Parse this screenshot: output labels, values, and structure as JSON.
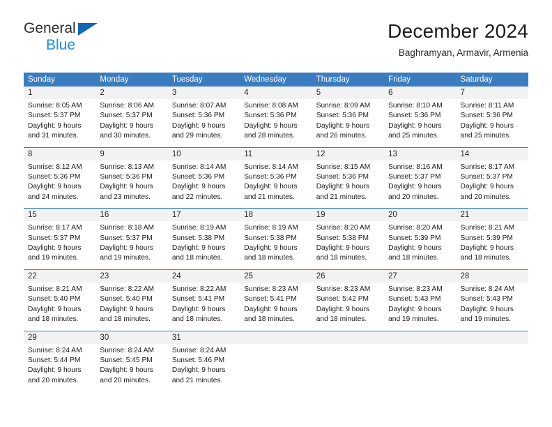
{
  "logo": {
    "word1": "General",
    "word2": "Blue",
    "triangle_color": "#1168b3",
    "word2_color": "#1b8ae0"
  },
  "header": {
    "title": "December 2024",
    "subtitle": "Baghramyan, Armavir, Armenia"
  },
  "theme": {
    "header_row_color": "#3b7cc0",
    "daynum_row_color": "#f2f2f2",
    "cell_bg": "#ffffff",
    "text_color": "#1a1a1a"
  },
  "weekdays": [
    "Sunday",
    "Monday",
    "Tuesday",
    "Wednesday",
    "Thursday",
    "Friday",
    "Saturday"
  ],
  "weeks": [
    [
      {
        "day": "1",
        "sunrise": "Sunrise: 8:05 AM",
        "sunset": "Sunset: 5:37 PM",
        "daylight1": "Daylight: 9 hours",
        "daylight2": "and 31 minutes."
      },
      {
        "day": "2",
        "sunrise": "Sunrise: 8:06 AM",
        "sunset": "Sunset: 5:37 PM",
        "daylight1": "Daylight: 9 hours",
        "daylight2": "and 30 minutes."
      },
      {
        "day": "3",
        "sunrise": "Sunrise: 8:07 AM",
        "sunset": "Sunset: 5:36 PM",
        "daylight1": "Daylight: 9 hours",
        "daylight2": "and 29 minutes."
      },
      {
        "day": "4",
        "sunrise": "Sunrise: 8:08 AM",
        "sunset": "Sunset: 5:36 PM",
        "daylight1": "Daylight: 9 hours",
        "daylight2": "and 28 minutes."
      },
      {
        "day": "5",
        "sunrise": "Sunrise: 8:09 AM",
        "sunset": "Sunset: 5:36 PM",
        "daylight1": "Daylight: 9 hours",
        "daylight2": "and 26 minutes."
      },
      {
        "day": "6",
        "sunrise": "Sunrise: 8:10 AM",
        "sunset": "Sunset: 5:36 PM",
        "daylight1": "Daylight: 9 hours",
        "daylight2": "and 25 minutes."
      },
      {
        "day": "7",
        "sunrise": "Sunrise: 8:11 AM",
        "sunset": "Sunset: 5:36 PM",
        "daylight1": "Daylight: 9 hours",
        "daylight2": "and 25 minutes."
      }
    ],
    [
      {
        "day": "8",
        "sunrise": "Sunrise: 8:12 AM",
        "sunset": "Sunset: 5:36 PM",
        "daylight1": "Daylight: 9 hours",
        "daylight2": "and 24 minutes."
      },
      {
        "day": "9",
        "sunrise": "Sunrise: 8:13 AM",
        "sunset": "Sunset: 5:36 PM",
        "daylight1": "Daylight: 9 hours",
        "daylight2": "and 23 minutes."
      },
      {
        "day": "10",
        "sunrise": "Sunrise: 8:14 AM",
        "sunset": "Sunset: 5:36 PM",
        "daylight1": "Daylight: 9 hours",
        "daylight2": "and 22 minutes."
      },
      {
        "day": "11",
        "sunrise": "Sunrise: 8:14 AM",
        "sunset": "Sunset: 5:36 PM",
        "daylight1": "Daylight: 9 hours",
        "daylight2": "and 21 minutes."
      },
      {
        "day": "12",
        "sunrise": "Sunrise: 8:15 AM",
        "sunset": "Sunset: 5:36 PM",
        "daylight1": "Daylight: 9 hours",
        "daylight2": "and 21 minutes."
      },
      {
        "day": "13",
        "sunrise": "Sunrise: 8:16 AM",
        "sunset": "Sunset: 5:37 PM",
        "daylight1": "Daylight: 9 hours",
        "daylight2": "and 20 minutes."
      },
      {
        "day": "14",
        "sunrise": "Sunrise: 8:17 AM",
        "sunset": "Sunset: 5:37 PM",
        "daylight1": "Daylight: 9 hours",
        "daylight2": "and 20 minutes."
      }
    ],
    [
      {
        "day": "15",
        "sunrise": "Sunrise: 8:17 AM",
        "sunset": "Sunset: 5:37 PM",
        "daylight1": "Daylight: 9 hours",
        "daylight2": "and 19 minutes."
      },
      {
        "day": "16",
        "sunrise": "Sunrise: 8:18 AM",
        "sunset": "Sunset: 5:37 PM",
        "daylight1": "Daylight: 9 hours",
        "daylight2": "and 19 minutes."
      },
      {
        "day": "17",
        "sunrise": "Sunrise: 8:19 AM",
        "sunset": "Sunset: 5:38 PM",
        "daylight1": "Daylight: 9 hours",
        "daylight2": "and 18 minutes."
      },
      {
        "day": "18",
        "sunrise": "Sunrise: 8:19 AM",
        "sunset": "Sunset: 5:38 PM",
        "daylight1": "Daylight: 9 hours",
        "daylight2": "and 18 minutes."
      },
      {
        "day": "19",
        "sunrise": "Sunrise: 8:20 AM",
        "sunset": "Sunset: 5:38 PM",
        "daylight1": "Daylight: 9 hours",
        "daylight2": "and 18 minutes."
      },
      {
        "day": "20",
        "sunrise": "Sunrise: 8:20 AM",
        "sunset": "Sunset: 5:39 PM",
        "daylight1": "Daylight: 9 hours",
        "daylight2": "and 18 minutes."
      },
      {
        "day": "21",
        "sunrise": "Sunrise: 8:21 AM",
        "sunset": "Sunset: 5:39 PM",
        "daylight1": "Daylight: 9 hours",
        "daylight2": "and 18 minutes."
      }
    ],
    [
      {
        "day": "22",
        "sunrise": "Sunrise: 8:21 AM",
        "sunset": "Sunset: 5:40 PM",
        "daylight1": "Daylight: 9 hours",
        "daylight2": "and 18 minutes."
      },
      {
        "day": "23",
        "sunrise": "Sunrise: 8:22 AM",
        "sunset": "Sunset: 5:40 PM",
        "daylight1": "Daylight: 9 hours",
        "daylight2": "and 18 minutes."
      },
      {
        "day": "24",
        "sunrise": "Sunrise: 8:22 AM",
        "sunset": "Sunset: 5:41 PM",
        "daylight1": "Daylight: 9 hours",
        "daylight2": "and 18 minutes."
      },
      {
        "day": "25",
        "sunrise": "Sunrise: 8:23 AM",
        "sunset": "Sunset: 5:41 PM",
        "daylight1": "Daylight: 9 hours",
        "daylight2": "and 18 minutes."
      },
      {
        "day": "26",
        "sunrise": "Sunrise: 8:23 AM",
        "sunset": "Sunset: 5:42 PM",
        "daylight1": "Daylight: 9 hours",
        "daylight2": "and 18 minutes."
      },
      {
        "day": "27",
        "sunrise": "Sunrise: 8:23 AM",
        "sunset": "Sunset: 5:43 PM",
        "daylight1": "Daylight: 9 hours",
        "daylight2": "and 19 minutes."
      },
      {
        "day": "28",
        "sunrise": "Sunrise: 8:24 AM",
        "sunset": "Sunset: 5:43 PM",
        "daylight1": "Daylight: 9 hours",
        "daylight2": "and 19 minutes."
      }
    ],
    [
      {
        "day": "29",
        "sunrise": "Sunrise: 8:24 AM",
        "sunset": "Sunset: 5:44 PM",
        "daylight1": "Daylight: 9 hours",
        "daylight2": "and 20 minutes."
      },
      {
        "day": "30",
        "sunrise": "Sunrise: 8:24 AM",
        "sunset": "Sunset: 5:45 PM",
        "daylight1": "Daylight: 9 hours",
        "daylight2": "and 20 minutes."
      },
      {
        "day": "31",
        "sunrise": "Sunrise: 8:24 AM",
        "sunset": "Sunset: 5:46 PM",
        "daylight1": "Daylight: 9 hours",
        "daylight2": "and 21 minutes."
      },
      {
        "day": "",
        "sunrise": "",
        "sunset": "",
        "daylight1": "",
        "daylight2": ""
      },
      {
        "day": "",
        "sunrise": "",
        "sunset": "",
        "daylight1": "",
        "daylight2": ""
      },
      {
        "day": "",
        "sunrise": "",
        "sunset": "",
        "daylight1": "",
        "daylight2": ""
      },
      {
        "day": "",
        "sunrise": "",
        "sunset": "",
        "daylight1": "",
        "daylight2": ""
      }
    ]
  ]
}
